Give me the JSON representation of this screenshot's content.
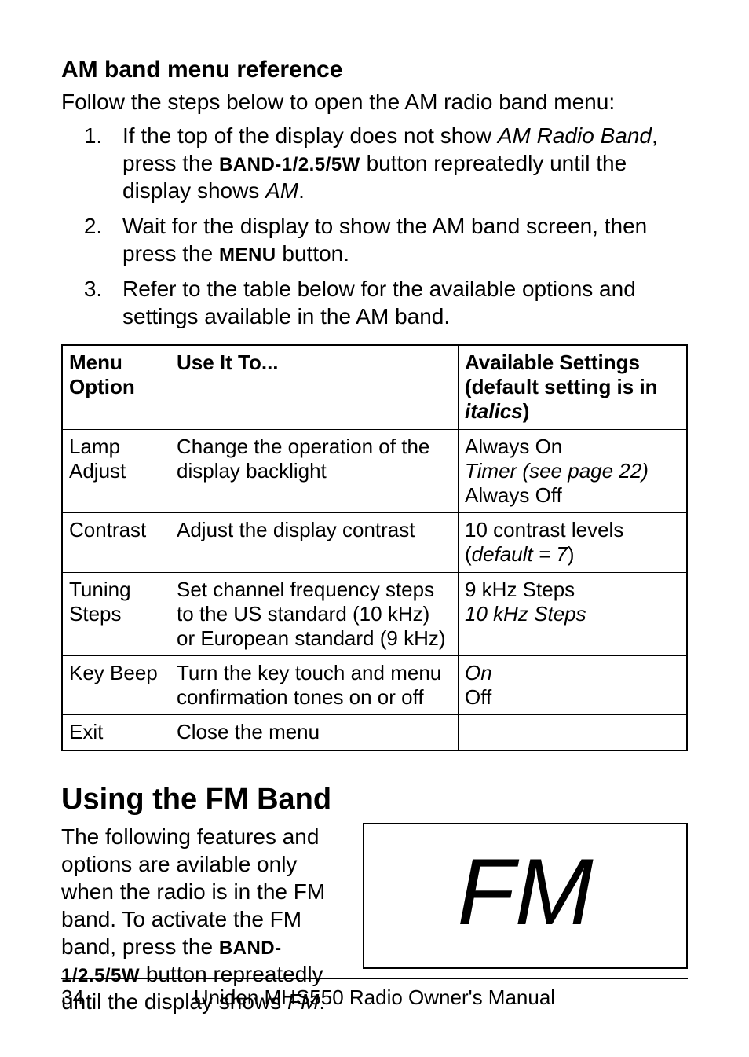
{
  "subhead": "AM band menu reference",
  "intro": "Follow the steps below to open the AM radio band menu:",
  "step1": {
    "pre": "If the top of the display does not show ",
    "italic1": "AM Radio Band",
    "mid1": ", press the ",
    "button": "BAND-1/2.5/5W",
    "mid2": " button repreatedly until the display shows ",
    "italic2": "AM",
    "post": "."
  },
  "step2": {
    "pre": "Wait for the display to show the AM band screen, then press the ",
    "button": "MENU",
    "post": " button."
  },
  "step3": "Refer to the table below for the available options and settings available in the AM band.",
  "table": {
    "head_menu": "Menu Option",
    "head_use": "Use It To...",
    "head_avail1": "Available Settings (default setting is in ",
    "head_avail_italic": "italics",
    "head_avail2": ")",
    "rows": [
      {
        "menu": "Lamp Adjust",
        "use": "Change the operation of the display backlight",
        "settings": {
          "plain1": "Always On",
          "ital": "Timer (see page 22)",
          "plain2": "Always Off"
        }
      },
      {
        "menu": "Contrast",
        "use": "Adjust the display contrast",
        "settings": {
          "plain1": "10 contrast levels",
          "ital_inline_pre": "(",
          "ital": "default = 7",
          "ital_inline_post": ")"
        }
      },
      {
        "menu": "Tuning Steps",
        "use": "Set channel frequency steps to the US standard (10 kHz) or European standard (9 kHz)",
        "settings": {
          "plain1": "9 kHz Steps",
          "ital": "10 kHz Steps"
        }
      },
      {
        "menu": "Key Beep",
        "use": "Turn the key touch and menu confirmation tones on or off",
        "settings": {
          "ital": "On",
          "plain2": "Off"
        }
      },
      {
        "menu": "Exit",
        "use": "Close the menu",
        "settings": {}
      }
    ]
  },
  "fm_heading": "Using the FM Band",
  "fm_para": {
    "pre": "The following features and options are avilable only when the radio is in the FM band. To activate the FM band, press the ",
    "button": "BAND-1/2.5/5W",
    "mid": " button repreatedly until the display shows ",
    "italic": "FM",
    "post": "."
  },
  "fm_box_label": "FM",
  "footer": {
    "page": "34",
    "title": "Uniden MHS550 Radio Owner's Manual"
  }
}
